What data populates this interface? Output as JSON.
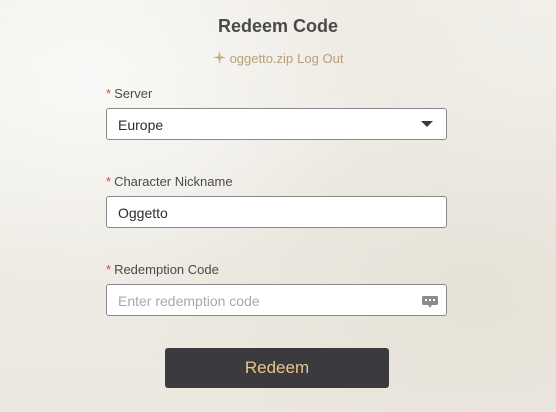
{
  "page": {
    "title": "Redeem Code"
  },
  "user": {
    "username": "oggetto.zip",
    "logout_label": "Log Out"
  },
  "form": {
    "required_mark": "*",
    "server": {
      "label": "Server",
      "value": "Europe"
    },
    "nickname": {
      "label": "Character Nickname",
      "value": "Oggetto"
    },
    "code": {
      "label": "Redemption Code",
      "value": "",
      "placeholder": "Enter redemption code"
    },
    "submit_label": "Redeem"
  },
  "icons": {
    "user": "sparkle-star-icon",
    "server_dropdown": "chevron-down-icon",
    "code_field": "keyboard-icon"
  },
  "colors": {
    "accent_gold": "#b49f78",
    "button_bg": "#3b3a3f",
    "button_text": "#e9c68a",
    "required": "#d84a3a"
  }
}
